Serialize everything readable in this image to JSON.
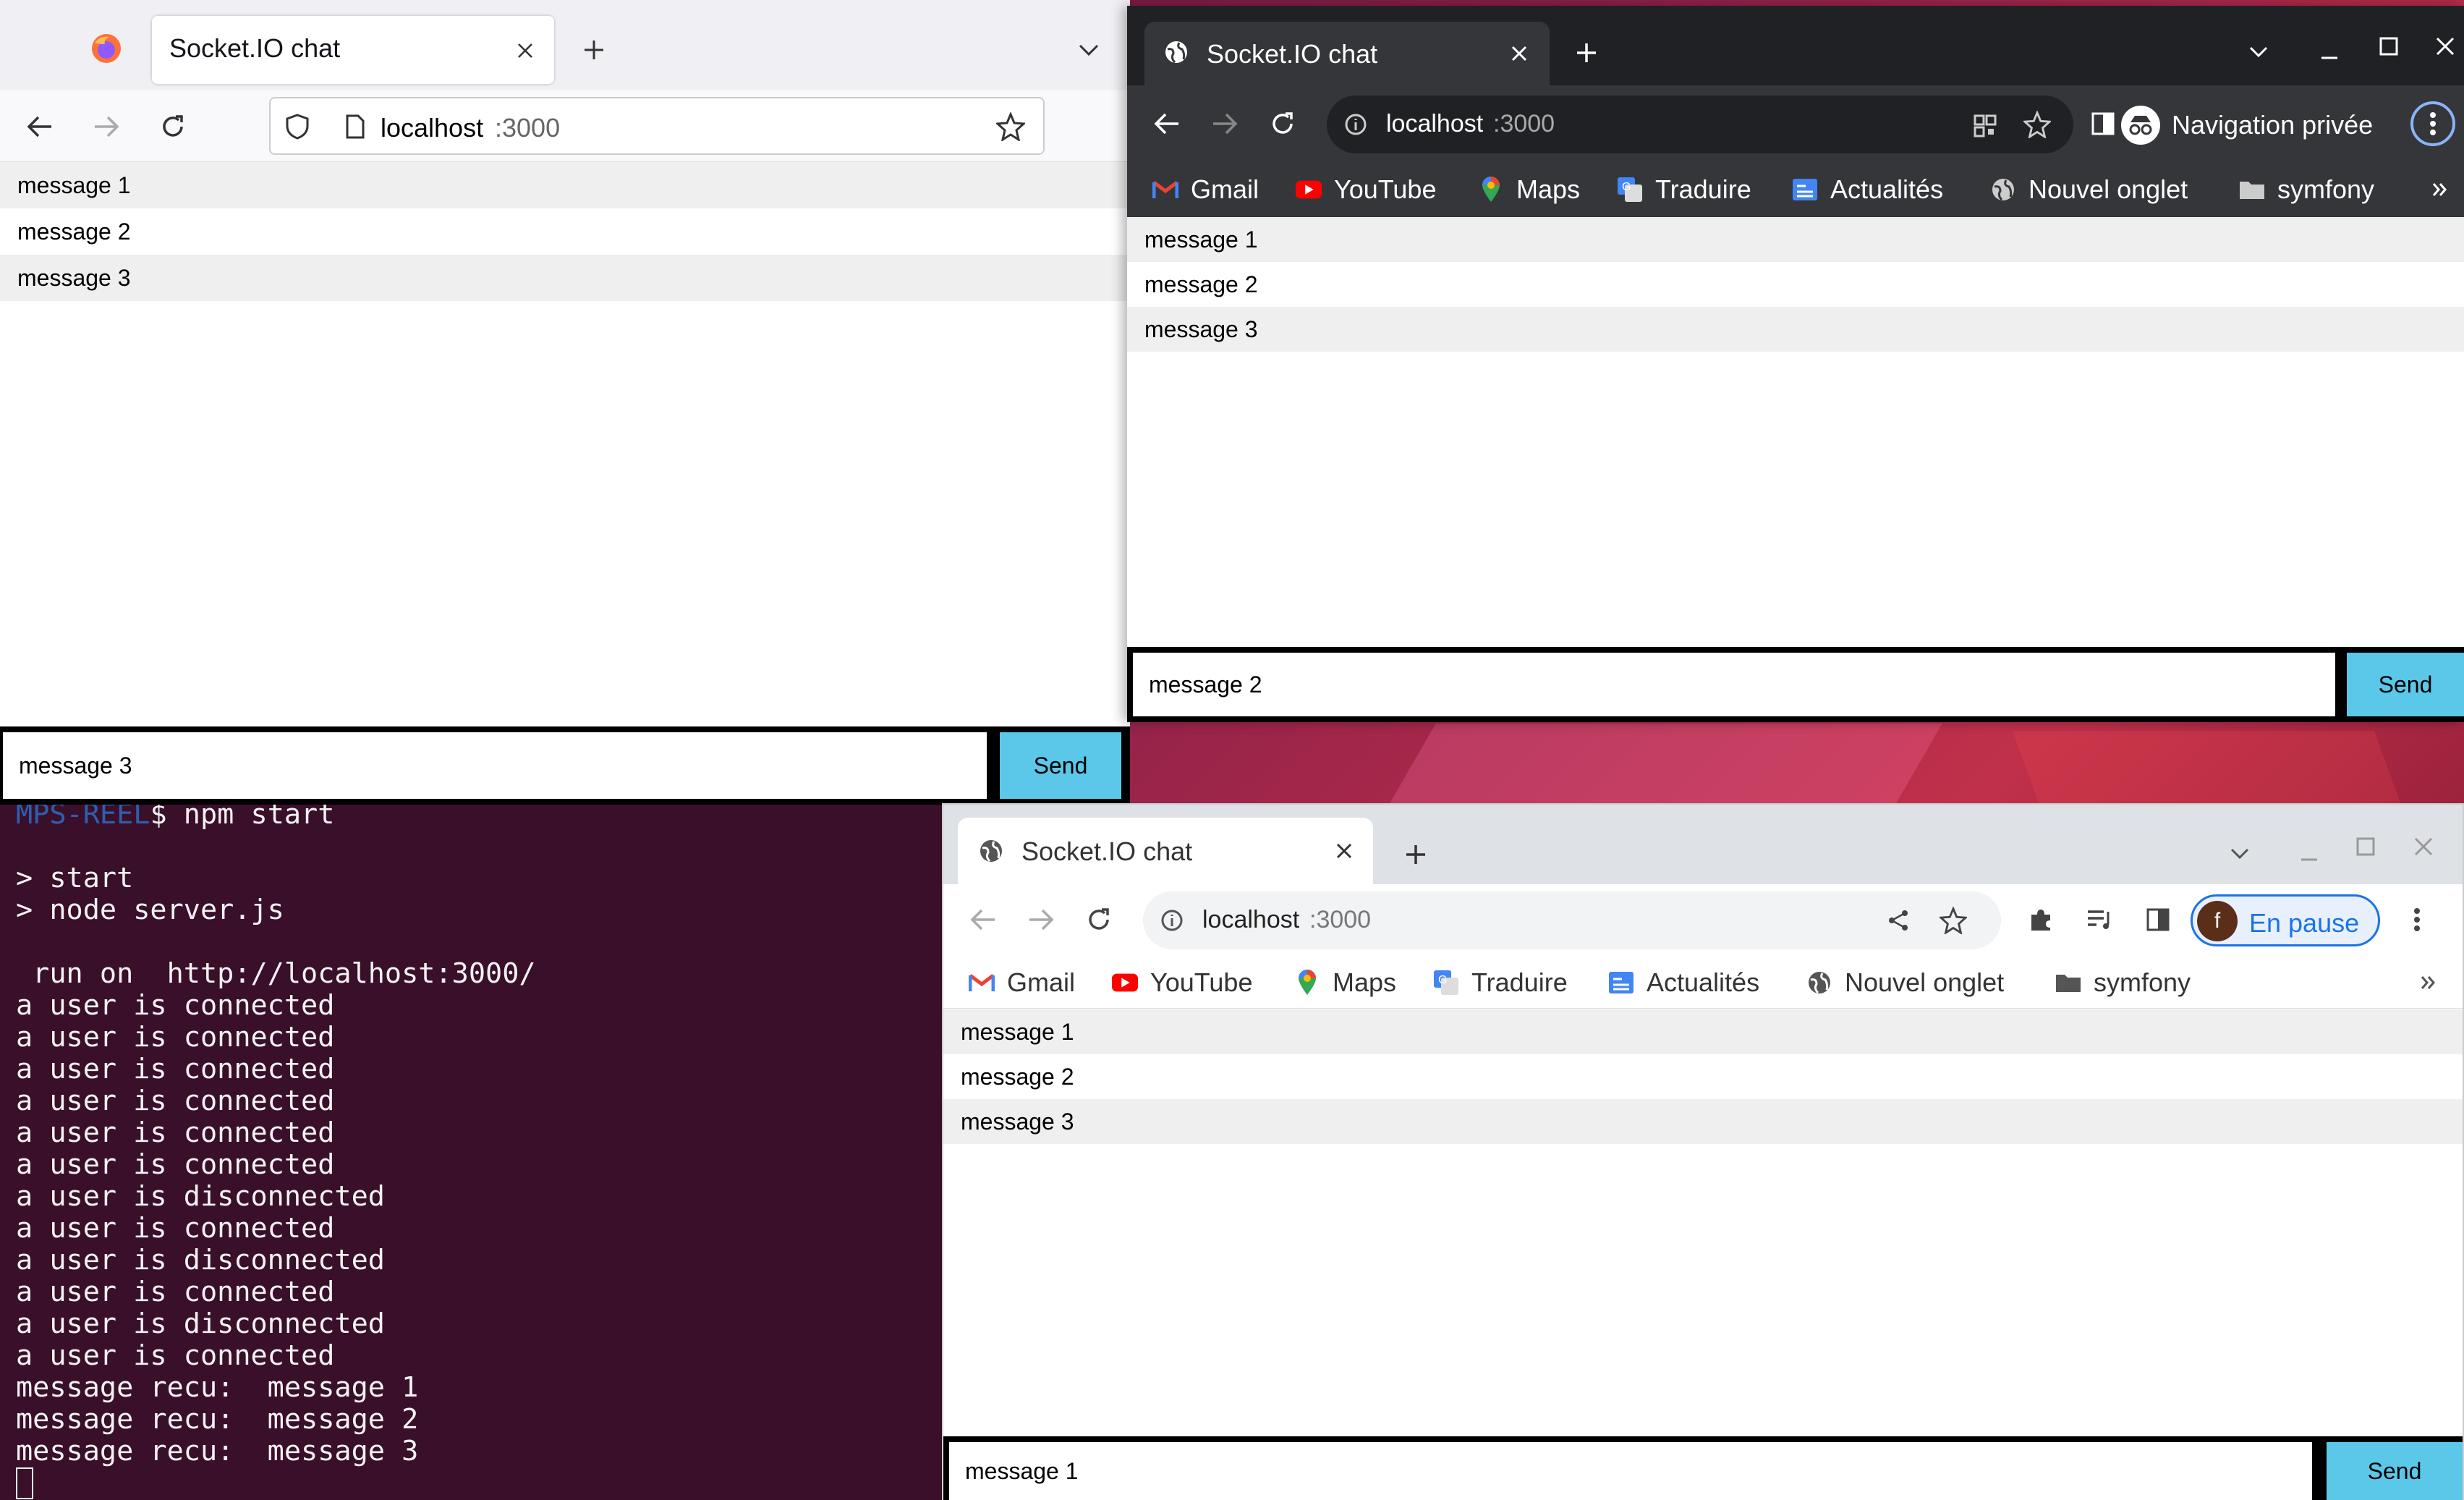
{
  "messages": [
    "message 1",
    "message 2",
    "message 3"
  ],
  "firefox": {
    "tab_title": "Socket.IO chat",
    "url_host": "localhost",
    "url_port": ":3000",
    "input_value": "message 3",
    "send_label": "Send"
  },
  "chrome_incognito": {
    "tab_title": "Socket.IO chat",
    "url_host": "localhost",
    "url_port": ":3000",
    "profile_label": "Navigation privée",
    "bookmarks": [
      "Gmail",
      "YouTube",
      "Maps",
      "Traduire",
      "Actualités",
      "Nouvel onglet",
      "symfony"
    ],
    "input_value": "message 2",
    "send_label": "Send"
  },
  "chrome_light": {
    "tab_title": "Socket.IO chat",
    "url_host": "localhost",
    "url_port": ":3000",
    "profile_label": "En pause",
    "avatar_letter": "f",
    "bookmarks": [
      "Gmail",
      "YouTube",
      "Maps",
      "Traduire",
      "Actualités",
      "Nouvel onglet",
      "symfony"
    ],
    "input_value": "message 1",
    "send_label": "Send"
  },
  "terminal": {
    "prompt_host": "MPS-REEL",
    "prompt_cmd": "$ npm start",
    "lines": [
      "",
      "> start",
      "> node server.js",
      "",
      " run on  http://localhost:3000/",
      "a user is connected",
      "a user is connected",
      "a user is connected",
      "a user is connected",
      "a user is connected",
      "a user is connected",
      "a user is disconnected",
      "a user is connected",
      "a user is disconnected",
      "a user is connected",
      "a user is disconnected",
      "a user is connected",
      "message recu:  message 1",
      "message recu:  message 2",
      "message recu:  message 3"
    ]
  },
  "colors": {
    "send_button": "#5bc8ea",
    "terminal_bg": "#3a0f2a",
    "incognito_bar": "#35363a"
  }
}
